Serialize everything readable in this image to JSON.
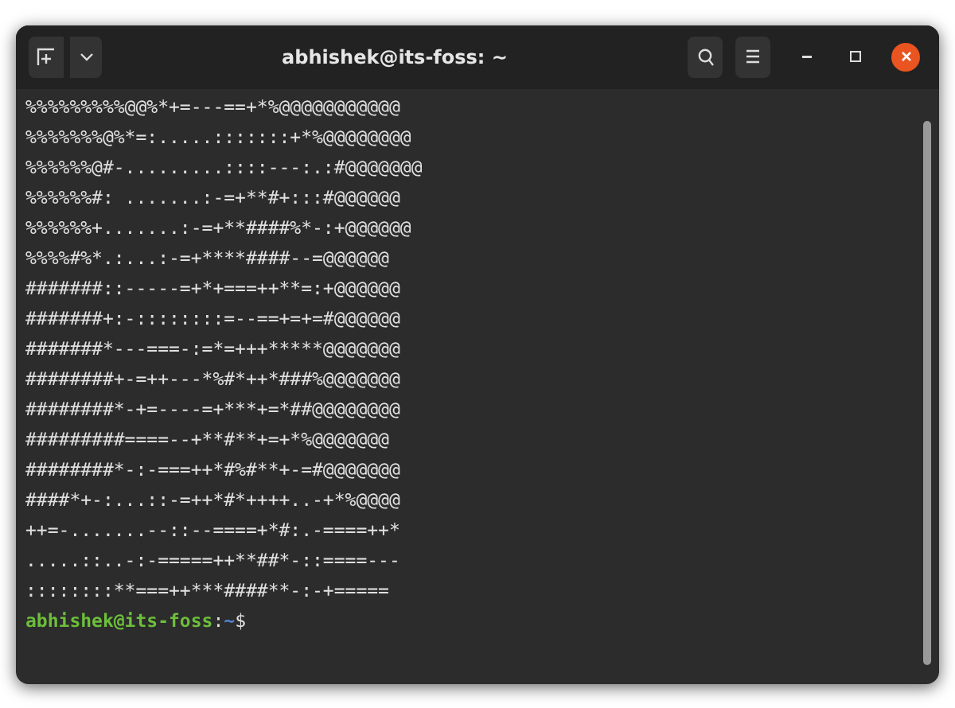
{
  "window": {
    "title": "abhishek@its-foss: ~"
  },
  "terminal": {
    "lines": [
      "%%%%%%%%%@@%*+=---==+*%@@@@@@@@@@@",
      "%%%%%%%@%*=:.....:::::::+*%@@@@@@@@",
      "%%%%%%@#-.........::::---:.:#@@@@@@@",
      "%%%%%%#: .......:-=+**#+:::#@@@@@@",
      "%%%%%%+.......:-=+**####%*-:+@@@@@@",
      "%%%%#%*.:...:-=+****####--=@@@@@@",
      "#######::-----=+*+===++**=:+@@@@@@",
      "#######+:-::::::::=--==+=+=#@@@@@@",
      "#######*---===-:=*=+++*****@@@@@@@",
      "########+-=++---*%#*++*###%@@@@@@@",
      "########*-+=----=+***+=*##@@@@@@@@",
      "#########====--+**#**+=+*%@@@@@@@",
      "########*-:-===++*#%#**+-=#@@@@@@@",
      "####*+-:...::-=++*#*++++..-+*%@@@@",
      "++=-.......--::--====+*#:.-====++*",
      ".....::..-:-=====++**##*-::====---",
      "::::::::**===++***####**-:-+====="
    ],
    "prompt": {
      "user_host": "abhishek@its-foss",
      "separator": ":",
      "path": "~",
      "symbol": "$"
    }
  }
}
